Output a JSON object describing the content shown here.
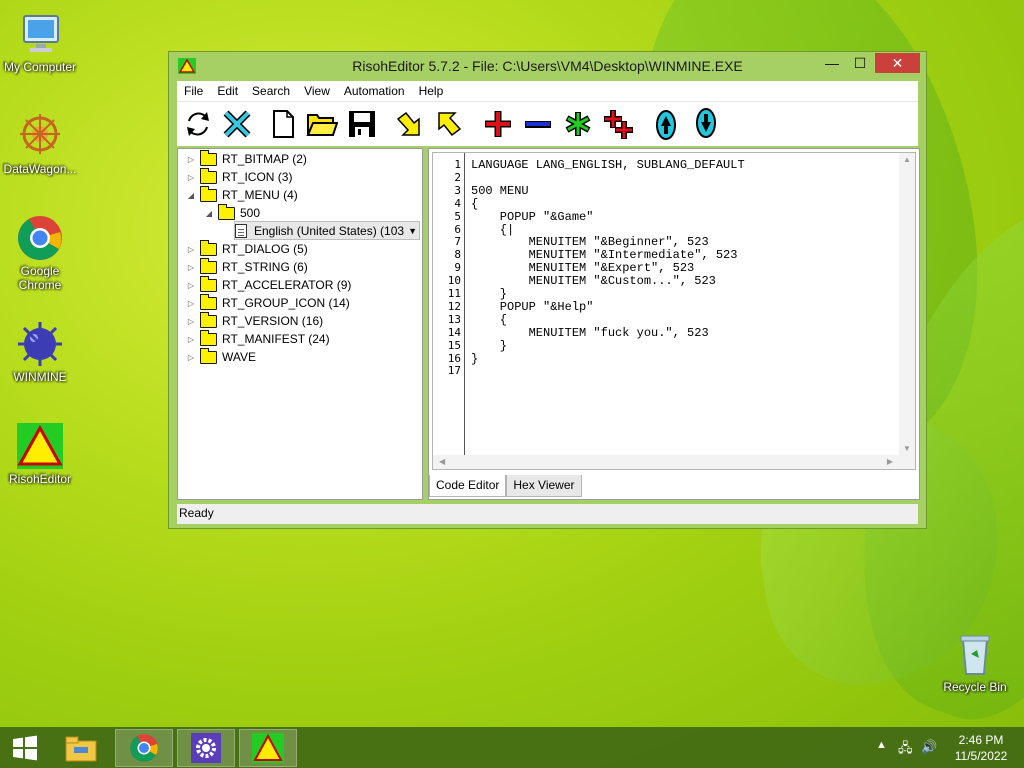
{
  "desktop": {
    "icons": [
      {
        "label": "My Computer"
      },
      {
        "label": "DataWagon..."
      },
      {
        "label": "Google Chrome"
      },
      {
        "label": "WINMINE"
      },
      {
        "label": "RisohEditor"
      },
      {
        "label": "Recycle Bin"
      }
    ]
  },
  "window": {
    "title": "RisohEditor 5.7.2 - File: C:\\Users\\VM4\\Desktop\\WINMINE.EXE",
    "controls": {
      "minimize": "—",
      "maximize": "☐",
      "close": "✕"
    }
  },
  "menu": [
    "File",
    "Edit",
    "Search",
    "View",
    "Automation",
    "Help"
  ],
  "toolbar": {
    "icons": [
      "refresh-icon",
      "close-x-icon",
      "new-file-icon",
      "open-folder-icon",
      "save-icon",
      "import-arrow-icon",
      "export-arrow-icon",
      "add-icon",
      "remove-icon",
      "star-icon",
      "add-multiple-icon",
      "move-up-icon",
      "move-down-icon"
    ]
  },
  "tree": {
    "items": [
      {
        "label": "RT_BITMAP (2)",
        "arrow": "▷"
      },
      {
        "label": "RT_ICON (3)",
        "arrow": "▷"
      },
      {
        "label": "RT_MENU (4)",
        "arrow": "◢"
      },
      {
        "label": "500",
        "arrow": "◢"
      },
      {
        "label": "English (United States) (103"
      },
      {
        "label": "RT_DIALOG (5)",
        "arrow": "▷"
      },
      {
        "label": "RT_STRING (6)",
        "arrow": "▷"
      },
      {
        "label": "RT_ACCELERATOR (9)",
        "arrow": "▷"
      },
      {
        "label": "RT_GROUP_ICON (14)",
        "arrow": "▷"
      },
      {
        "label": "RT_VERSION (16)",
        "arrow": "▷"
      },
      {
        "label": "RT_MANIFEST (24)",
        "arrow": "▷"
      },
      {
        "label": "WAVE",
        "arrow": "▷"
      }
    ]
  },
  "editor": {
    "lines": [
      "LANGUAGE LANG_ENGLISH, SUBLANG_DEFAULT",
      "",
      "500 MENU",
      "{",
      "    POPUP \"&Game\"",
      "    {|",
      "        MENUITEM \"&Beginner\", 523",
      "        MENUITEM \"&Intermediate\", 523",
      "        MENUITEM \"&Expert\", 523",
      "        MENUITEM \"&Custom...\", 523",
      "    }",
      "    POPUP \"&Help\"",
      "    {",
      "        MENUITEM \"fuck you.\", 523",
      "    }",
      "}",
      ""
    ],
    "line_numbers": [
      "1",
      "2",
      "3",
      "4",
      "5",
      "6",
      "7",
      "8",
      "9",
      "10",
      "11",
      "12",
      "13",
      "14",
      "15",
      "16",
      "17"
    ]
  },
  "tabs": [
    {
      "label": "Code Editor",
      "active": true
    },
    {
      "label": "Hex Viewer",
      "active": false
    }
  ],
  "status": {
    "text": "Ready"
  },
  "taskbar": {
    "items": [
      "start-icon",
      "file-explorer-icon",
      "chrome-icon",
      "settings-gear-icon",
      "risoh-editor-icon"
    ],
    "time": "2:46 PM",
    "date": "11/5/2022"
  },
  "colors": {
    "close_button": "#c9413a",
    "folder": "#fff200",
    "window_frame": "#a7d064"
  }
}
